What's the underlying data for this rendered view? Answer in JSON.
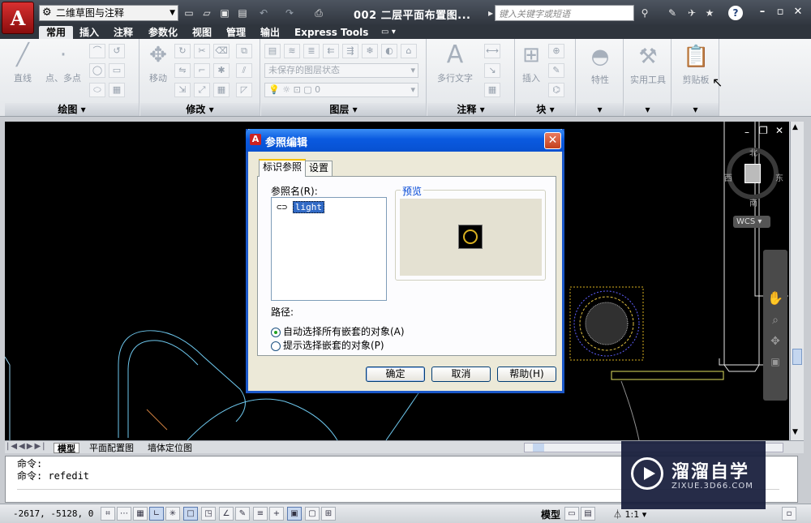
{
  "titlebar": {
    "app_logo": "A",
    "workspace": "二维草图与注释",
    "document_title": "002 二层平面布置图...",
    "search_placeholder": "键入关键字或短语",
    "help": "?",
    "minimize": "–",
    "restore": "▫",
    "close": "✕"
  },
  "ribbon": {
    "tabs": [
      "常用",
      "插入",
      "注释",
      "参数化",
      "视图",
      "管理",
      "输出",
      "Express Tools"
    ],
    "panels": {
      "draw": {
        "title": "绘图",
        "line": "直线",
        "point": "点、多点"
      },
      "modify": {
        "title": "修改",
        "move": "移动"
      },
      "layers": {
        "title": "图层",
        "state": "未保存的图层状态",
        "current": "0"
      },
      "annotation": {
        "title": "注释",
        "mtext": "多行文字"
      },
      "block": {
        "title": "块",
        "insert": "插入"
      },
      "properties": {
        "label": "特性"
      },
      "utilities": {
        "label": "实用工具"
      },
      "clipboard": {
        "label": "剪贴板"
      }
    }
  },
  "viewcube": {
    "north": "北",
    "south": "南",
    "east": "东",
    "west": "西",
    "wcs": "WCS"
  },
  "layout_tabs": [
    "模型",
    "平面配置图",
    "墙体定位图"
  ],
  "cmdline": {
    "line1": "命令:",
    "line2": "命令: refedit"
  },
  "statusbar": {
    "coords": "-2617, -5128, 0",
    "model": "模型",
    "scale": "1:1"
  },
  "dialog": {
    "title": "参照编辑",
    "tabs": [
      "标识参照",
      "设置"
    ],
    "refname_label": "参照名(R):",
    "ref_item": "light",
    "preview_label": "预览",
    "path_label": "路径:",
    "option_auto": "自动选择所有嵌套的对象(A)",
    "option_prompt": "提示选择嵌套的对象(P)",
    "ok": "确定",
    "cancel": "取消",
    "help": "帮助(H)",
    "close_glyph": "✕"
  },
  "watermark": {
    "title": "溜溜自学",
    "url": "ZIXUE.3D66.COM"
  }
}
